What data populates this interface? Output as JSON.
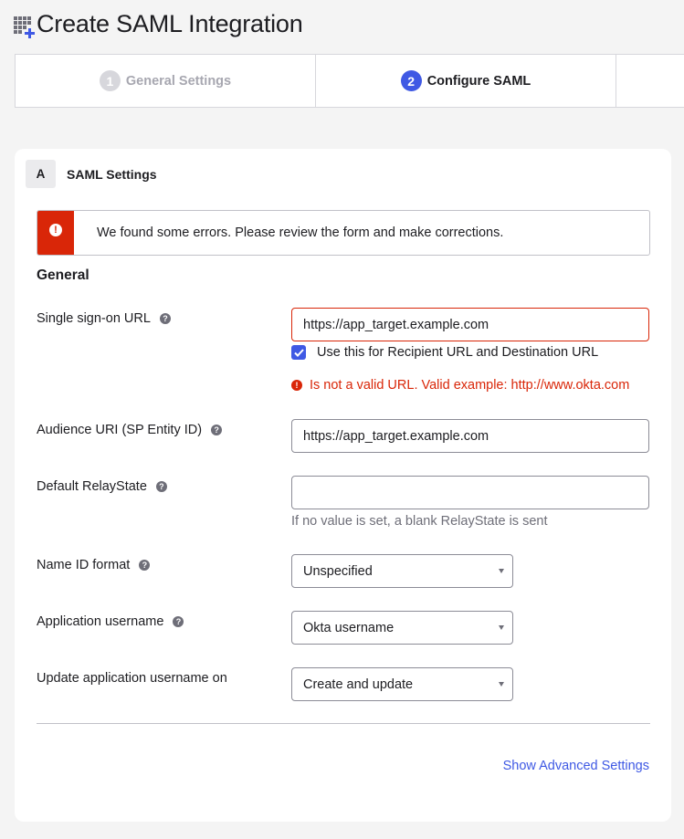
{
  "header": {
    "title": "Create SAML Integration",
    "icon": "app-grid-add-icon"
  },
  "stepper": {
    "steps": [
      {
        "number": "1",
        "label": "General Settings",
        "state": "inactive"
      },
      {
        "number": "2",
        "label": "Configure SAML",
        "state": "active"
      },
      {
        "number": "",
        "label": "",
        "state": "inactive"
      }
    ]
  },
  "section": {
    "letter": "A",
    "title": "SAML Settings"
  },
  "error_banner": {
    "icon": "exclamation-icon",
    "message": "We found some errors. Please review the form and make corrections."
  },
  "general": {
    "heading": "General"
  },
  "fields": {
    "sso_url": {
      "label": "Single sign-on URL",
      "value": "https://app_target.example.com",
      "checkbox_label": "Use this for Recipient URL and Destination URL",
      "checkbox_checked": true,
      "error": "Is not a valid URL. Valid example: http://www.okta.com"
    },
    "audience_uri": {
      "label": "Audience URI (SP Entity ID)",
      "value": "https://app_target.example.com"
    },
    "relay_state": {
      "label": "Default RelayState",
      "value": "",
      "hint": "If no value is set, a blank RelayState is sent"
    },
    "name_id_format": {
      "label": "Name ID format",
      "selected": "Unspecified"
    },
    "app_username": {
      "label": "Application username",
      "selected": "Okta username"
    },
    "update_username_on": {
      "label": "Update application username on",
      "selected": "Create and update"
    }
  },
  "help_glyph": "?",
  "advanced_link": "Show Advanced Settings",
  "colors": {
    "accent": "#3f59e4",
    "error": "#d92608",
    "background": "#f4f4f4"
  }
}
